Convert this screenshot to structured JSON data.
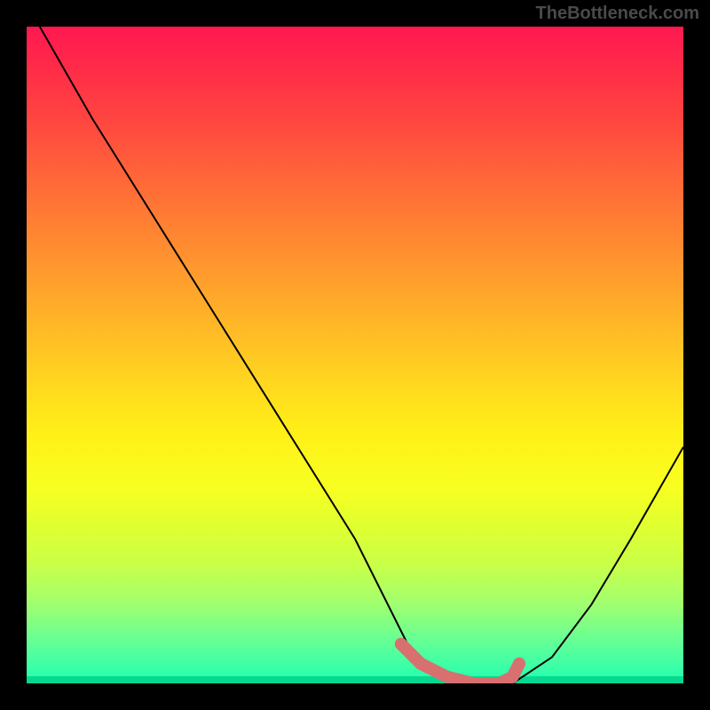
{
  "watermark": "TheBottleneck.com",
  "chart_data": {
    "type": "line",
    "title": "",
    "xlabel": "",
    "ylabel": "",
    "xlim": [
      0,
      100
    ],
    "ylim": [
      0,
      100
    ],
    "series": [
      {
        "name": "bottleneck-curve",
        "x": [
          2,
          10,
          20,
          30,
          40,
          50,
          55,
          58,
          62,
          66,
          70,
          74,
          80,
          86,
          92,
          100
        ],
        "values": [
          100,
          86,
          70,
          54,
          38,
          22,
          12,
          6,
          2,
          0,
          0,
          0,
          4,
          12,
          22,
          36
        ]
      }
    ],
    "highlight": {
      "name": "optimal-range",
      "x": [
        57,
        60,
        64,
        68,
        72,
        74,
        75
      ],
      "values": [
        6,
        3,
        1,
        0,
        0,
        1,
        3
      ]
    },
    "gradient_stops": [
      {
        "pos": 0,
        "color": "#ff1850"
      },
      {
        "pos": 50,
        "color": "#ffd620"
      },
      {
        "pos": 100,
        "color": "#06d890"
      }
    ]
  }
}
